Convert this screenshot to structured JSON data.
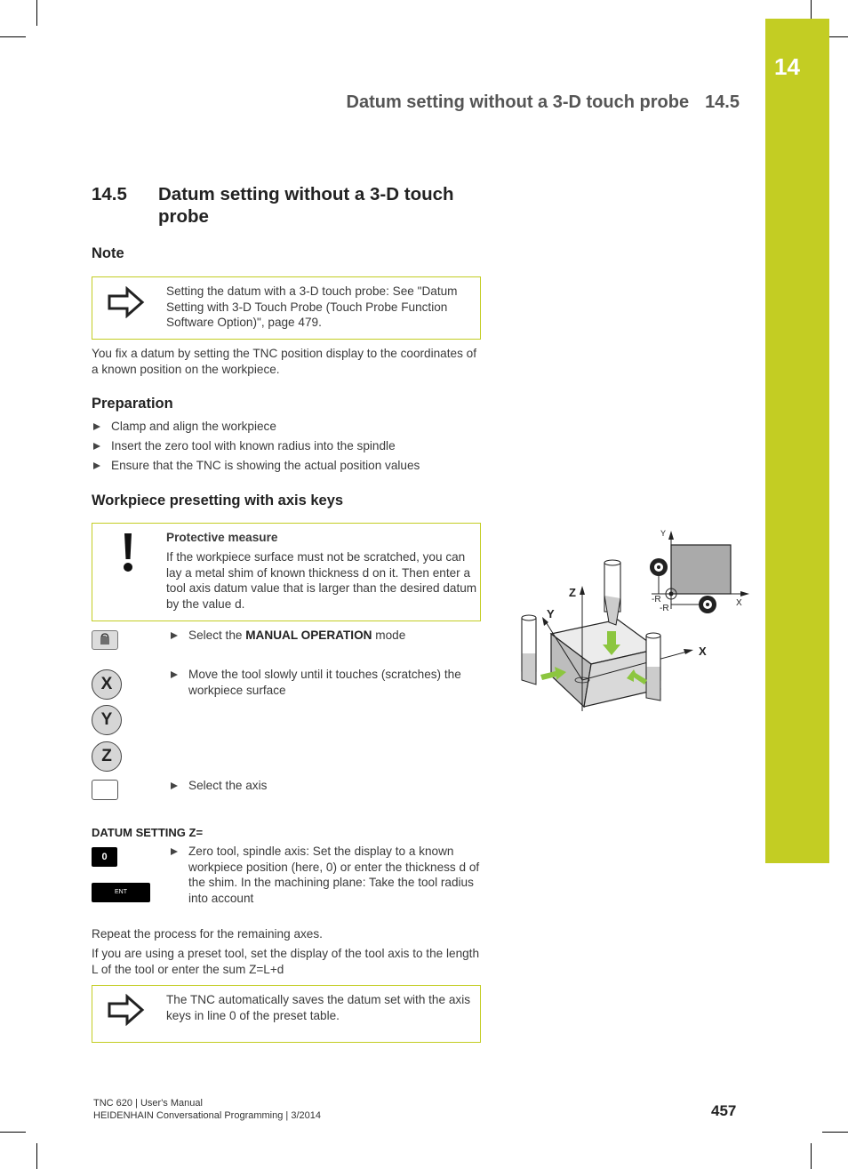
{
  "chapter": {
    "number": "14",
    "tab_color": "#c3cd23"
  },
  "running_head": {
    "title": "Datum setting without a 3-D touch probe",
    "section": "14.5"
  },
  "section": {
    "number": "14.5",
    "title": "Datum setting without a 3-D touch probe"
  },
  "note": {
    "heading": "Note",
    "box_icon": "arrow-right-icon",
    "box_text": "Setting the datum with a 3-D touch probe: See \"Datum Setting with 3-D Touch Probe (Touch Probe Function Software Option)\", page 479.",
    "paragraph": "You fix a datum by setting the TNC position display to the coordinates of a known position on the workpiece."
  },
  "preparation": {
    "heading": "Preparation",
    "steps": [
      "Clamp and align the workpiece",
      "Insert the zero tool with known radius into the spindle",
      "Ensure that the TNC is showing the actual position values"
    ]
  },
  "presetting": {
    "heading": "Workpiece presetting with axis keys",
    "warning": {
      "icon": "exclamation-icon",
      "title": "Protective measure",
      "text": "If the workpiece surface must not be scratched, you can lay a metal shim of known thickness d on it. Then enter a tool axis datum value that is larger than the desired datum by the value d."
    },
    "step_manual_prefix": "Select the ",
    "step_manual_bold": "MANUAL OPERATION",
    "step_manual_suffix": " mode",
    "step_move": "Move the tool slowly until it touches (scratches) the workpiece surface",
    "axis_keys": [
      "X",
      "Y",
      "Z"
    ],
    "step_select_axis": "Select the axis",
    "dialog_label": "DATUM SETTING Z=",
    "key_zero": "0",
    "key_ent": "ENT",
    "step_zero_tool": "Zero tool, spindle axis: Set the display to a known workpiece position (here, 0) or enter the thickness d of the shim. In the machining plane: Take the tool radius into account",
    "repeat_text": "Repeat the process for the remaining axes.",
    "preset_tool_text": "If you are using a preset tool, set the display of the tool axis to the length L of the tool or enter the sum Z=L+d",
    "final_box_icon": "arrow-right-icon",
    "final_box_text": "The TNC automatically saves the datum set with the axis keys in line 0 of the preset table."
  },
  "figure": {
    "labels_3d": {
      "z": "Z",
      "y": "Y",
      "x": "X"
    },
    "labels_2d": {
      "y": "Y",
      "x": "X",
      "minus_r_left": "-R",
      "minus_r_bottom": "-R"
    },
    "arrow_color": "#8cc63f"
  },
  "footer": {
    "line1": "TNC 620 | User's Manual",
    "line2": "HEIDENHAIN Conversational Programming | 3/2014",
    "page": "457"
  }
}
